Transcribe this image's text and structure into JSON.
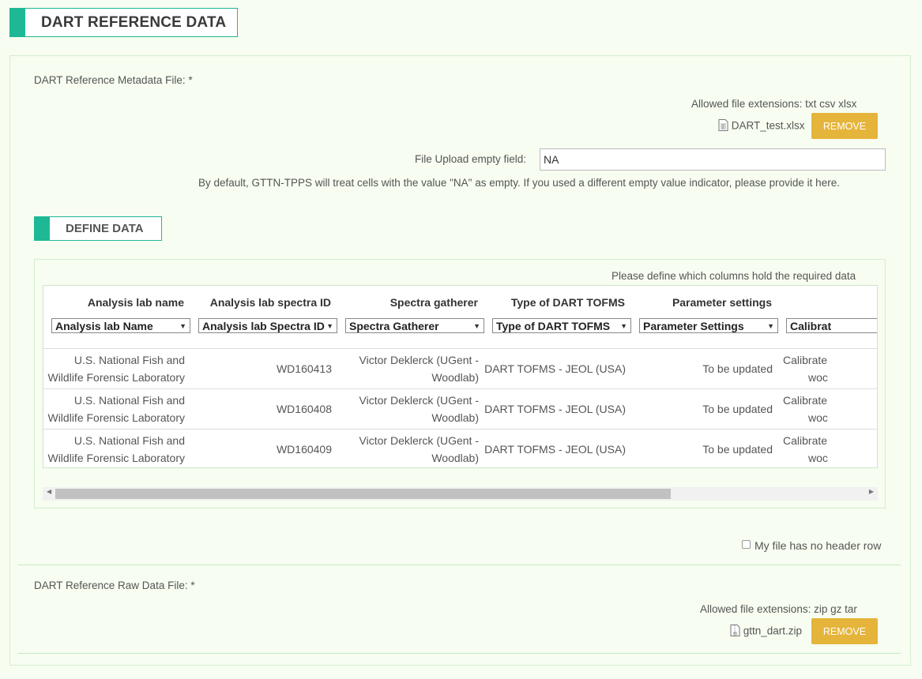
{
  "page": {
    "title": "DART REFERENCE DATA"
  },
  "metadata_file": {
    "label": "DART Reference Metadata File: *",
    "allowed": "Allowed file extensions: txt csv xlsx",
    "filename": "DART_test.xlsx",
    "remove_label": "REMOVE",
    "empty_field_label": "File Upload empty field:",
    "empty_field_value": "NA",
    "help": "By default, GTTN-TPPS will treat cells with the value \"NA\" as empty. If you used a different empty value indicator, please provide it here."
  },
  "define_data": {
    "title": "DEFINE DATA",
    "instruction": "Please define which columns hold the required data",
    "columns": [
      {
        "header": "Analysis lab name",
        "select": "Analysis lab Name"
      },
      {
        "header": "Analysis lab spectra ID",
        "select": "Analysis lab Spectra ID"
      },
      {
        "header": "Spectra gatherer",
        "select": "Spectra Gatherer"
      },
      {
        "header": "Type of DART TOFMS",
        "select": "Type of DART TOFMS"
      },
      {
        "header": "Parameter settings",
        "select": "Parameter Settings"
      },
      {
        "header": "",
        "select": "Calibrat"
      }
    ],
    "rows": [
      {
        "c1a": "U.S. National Fish and",
        "c1b": "Wildlife Forensic Laboratory",
        "c2": "WD160413",
        "c3a": "Victor Deklerck (UGent -",
        "c3b": "Woodlab)",
        "c4": "DART TOFMS - JEOL (USA)",
        "c5": "To be updated",
        "c6a": "Calibrate",
        "c6b": "woc"
      },
      {
        "c1a": "U.S. National Fish and",
        "c1b": "Wildlife Forensic Laboratory",
        "c2": "WD160408",
        "c3a": "Victor Deklerck (UGent -",
        "c3b": "Woodlab)",
        "c4": "DART TOFMS - JEOL (USA)",
        "c5": "To be updated",
        "c6a": "Calibrate",
        "c6b": "woc"
      },
      {
        "c1a": "U.S. National Fish and",
        "c1b": "Wildlife Forensic Laboratory",
        "c2": "WD160409",
        "c3a": "Victor Deklerck (UGent -",
        "c3b": "Woodlab)",
        "c4": "DART TOFMS - JEOL (USA)",
        "c5": "To be updated",
        "c6a": "Calibrate",
        "c6b": "woc"
      }
    ],
    "no_header_label": "My file has no header row",
    "no_header_checked": false
  },
  "raw_file": {
    "label": "DART Reference Raw Data File: *",
    "allowed": "Allowed file extensions: zip gz tar",
    "filename": "gttn_dart.zip",
    "remove_label": "REMOVE"
  },
  "colors": {
    "accent": "#1fb896",
    "remove_button": "#e5b43b",
    "background": "#f7fdf0"
  },
  "icons": {
    "xlsx_file": "spreadsheet-file-icon",
    "zip_file": "archive-file-icon"
  }
}
